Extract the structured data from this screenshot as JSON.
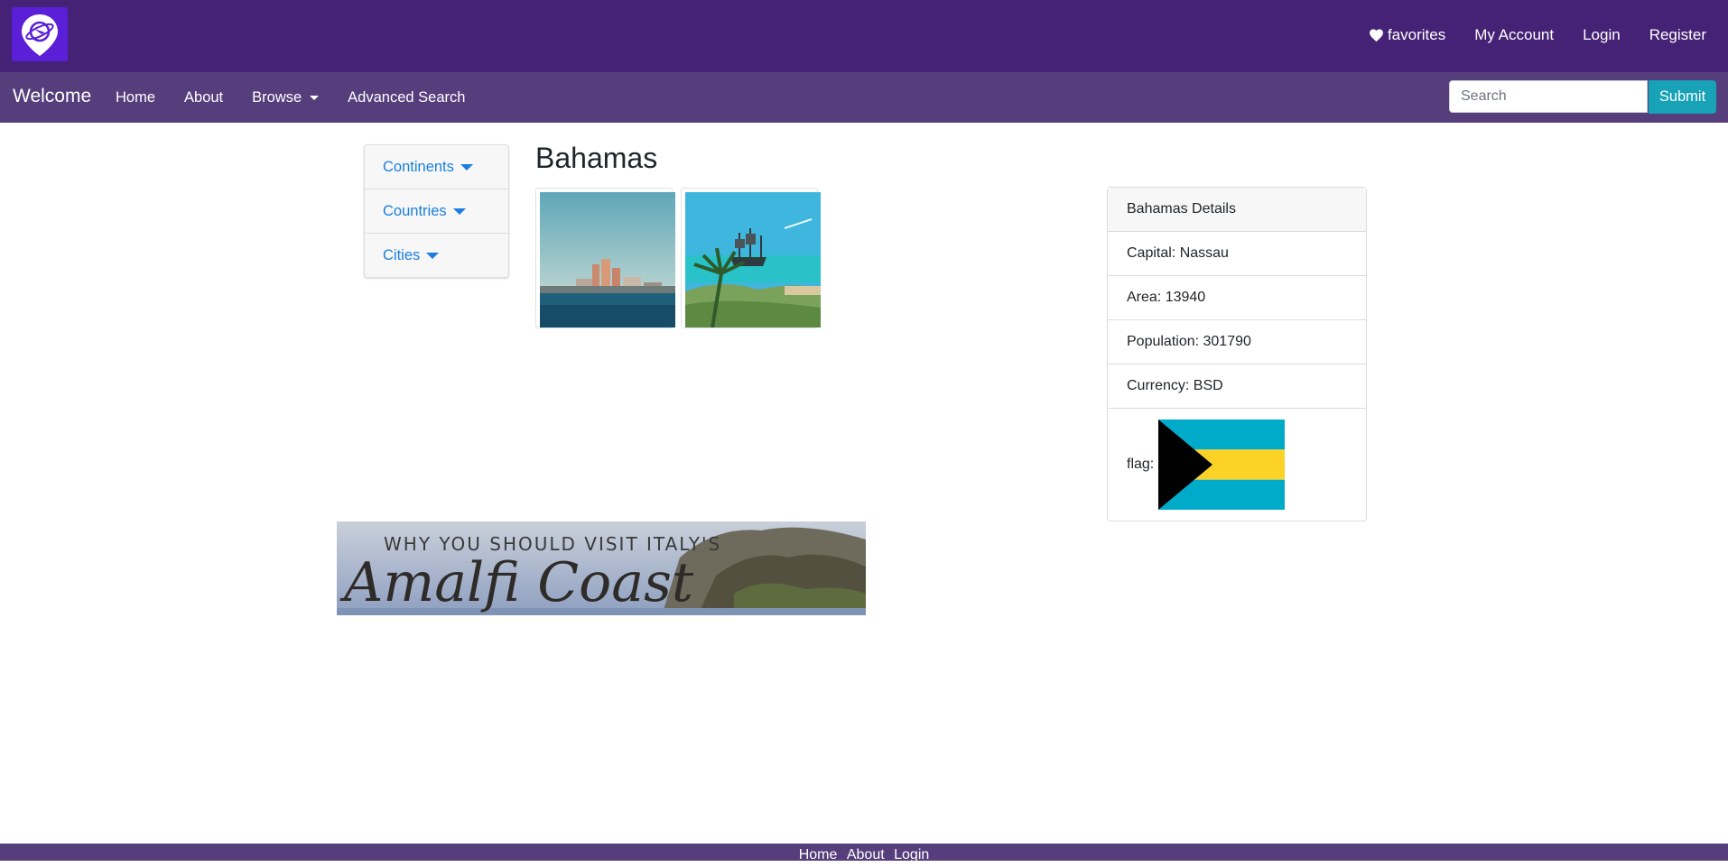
{
  "header": {
    "logo_icon": "globe-pin-icon",
    "nav": {
      "favorites": "favorites",
      "my_account": "My Account",
      "login": "Login",
      "register": "Register"
    }
  },
  "navbar": {
    "brand": "Welcome",
    "links": {
      "home": "Home",
      "about": "About",
      "browse": "Browse",
      "advanced_search": "Advanced Search"
    },
    "search": {
      "placeholder": "Search",
      "value": "",
      "submit": "Submit"
    }
  },
  "sidebar": {
    "items": [
      {
        "label": "Continents"
      },
      {
        "label": "Countries"
      },
      {
        "label": "Cities"
      }
    ]
  },
  "main": {
    "title": "Bahamas",
    "photos": [
      "photo-resort-skyline",
      "photo-pirate-ship-beach"
    ]
  },
  "details": {
    "header": "Bahamas Details",
    "capital": "Capital: Nassau",
    "area": "Area: 13940",
    "population": "Population: 301790",
    "currency": "Currency: BSD",
    "flag_label": "flag:"
  },
  "banner": {
    "line1": "WHY YOU SHOULD VISIT ITALY'S",
    "line2": "Amalfi Coast"
  },
  "footer": {
    "home": "Home",
    "about": "About",
    "login": "Login"
  },
  "colors": {
    "topbar": "#452275",
    "navbar": "#563d7c",
    "accent_teal": "#17a2b8",
    "link_blue": "#1a7fe0"
  }
}
